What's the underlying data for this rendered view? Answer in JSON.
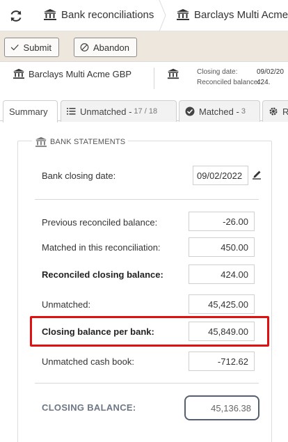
{
  "breadcrumb": {
    "item1": "Bank reconciliations",
    "item2": "Barclays Multi Acme"
  },
  "actions": {
    "submit_label": "Submit",
    "abandon_label": "Abandon"
  },
  "header": {
    "account_name": "Barclays Multi Acme GBP",
    "closing_date_label": "Closing date:",
    "closing_date_value": "09/02/20",
    "reconciled_balance_label": "Reconciled balance:",
    "reconciled_balance_value": "424."
  },
  "tabs": {
    "summary": "Summary",
    "unmatched": "Unmatched -",
    "unmatched_count": "17 / 18",
    "matched": "Matched -",
    "matched_count": "3",
    "rules": "R"
  },
  "statements": {
    "title": "BANK STATEMENTS",
    "closing_date_label": "Bank closing date:",
    "closing_date_value": "09/02/2022",
    "rows": {
      "previous_label": "Previous reconciled balance:",
      "previous_value": "-26.00",
      "matched_label": "Matched in this reconciliation:",
      "matched_value": "450.00",
      "reconciled_label": "Reconciled closing balance:",
      "reconciled_value": "424.00",
      "unmatched_label": "Unmatched:",
      "unmatched_value": "45,425.00",
      "per_bank_label": "Closing balance per bank:",
      "per_bank_value": "45,849.00",
      "cashbook_label": "Unmatched cash book:",
      "cashbook_value": "-712.62"
    },
    "closing_balance_label": "CLOSING BALANCE:",
    "closing_balance_value": "45,136.38"
  },
  "colors": {
    "action_bar_bg": "#ede7de",
    "highlight_border": "#e01010",
    "closing_label": "#6d7785"
  }
}
